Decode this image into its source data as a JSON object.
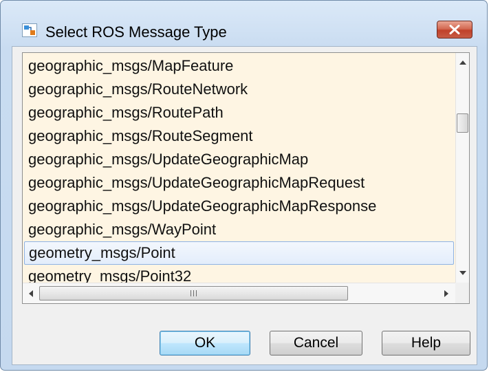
{
  "window": {
    "title": "Select ROS Message Type",
    "close_symbol": "x"
  },
  "list": {
    "items": [
      "geographic_msgs/MapFeature",
      "geographic_msgs/RouteNetwork",
      "geographic_msgs/RoutePath",
      "geographic_msgs/RouteSegment",
      "geographic_msgs/UpdateGeographicMap",
      "geographic_msgs/UpdateGeographicMapRequest",
      "geographic_msgs/UpdateGeographicMapResponse",
      "geographic_msgs/WayPoint",
      "geometry_msgs/Point",
      "geometry_msgs/Point32"
    ],
    "selected_index": 8
  },
  "buttons": {
    "ok": "OK",
    "cancel": "Cancel",
    "help": "Help"
  },
  "icons": {
    "app": "ros-app-icon",
    "close": "close-icon",
    "scroll_up": "scroll-up-arrow-icon",
    "scroll_down": "scroll-down-arrow-icon",
    "scroll_left": "scroll-left-arrow-icon",
    "scroll_right": "scroll-right-arrow-icon"
  },
  "colors": {
    "list_background": "#fef5e3",
    "selection_border": "#8db2e3",
    "default_button_border": "#3c7fb1",
    "close_button": "#c7503a"
  }
}
